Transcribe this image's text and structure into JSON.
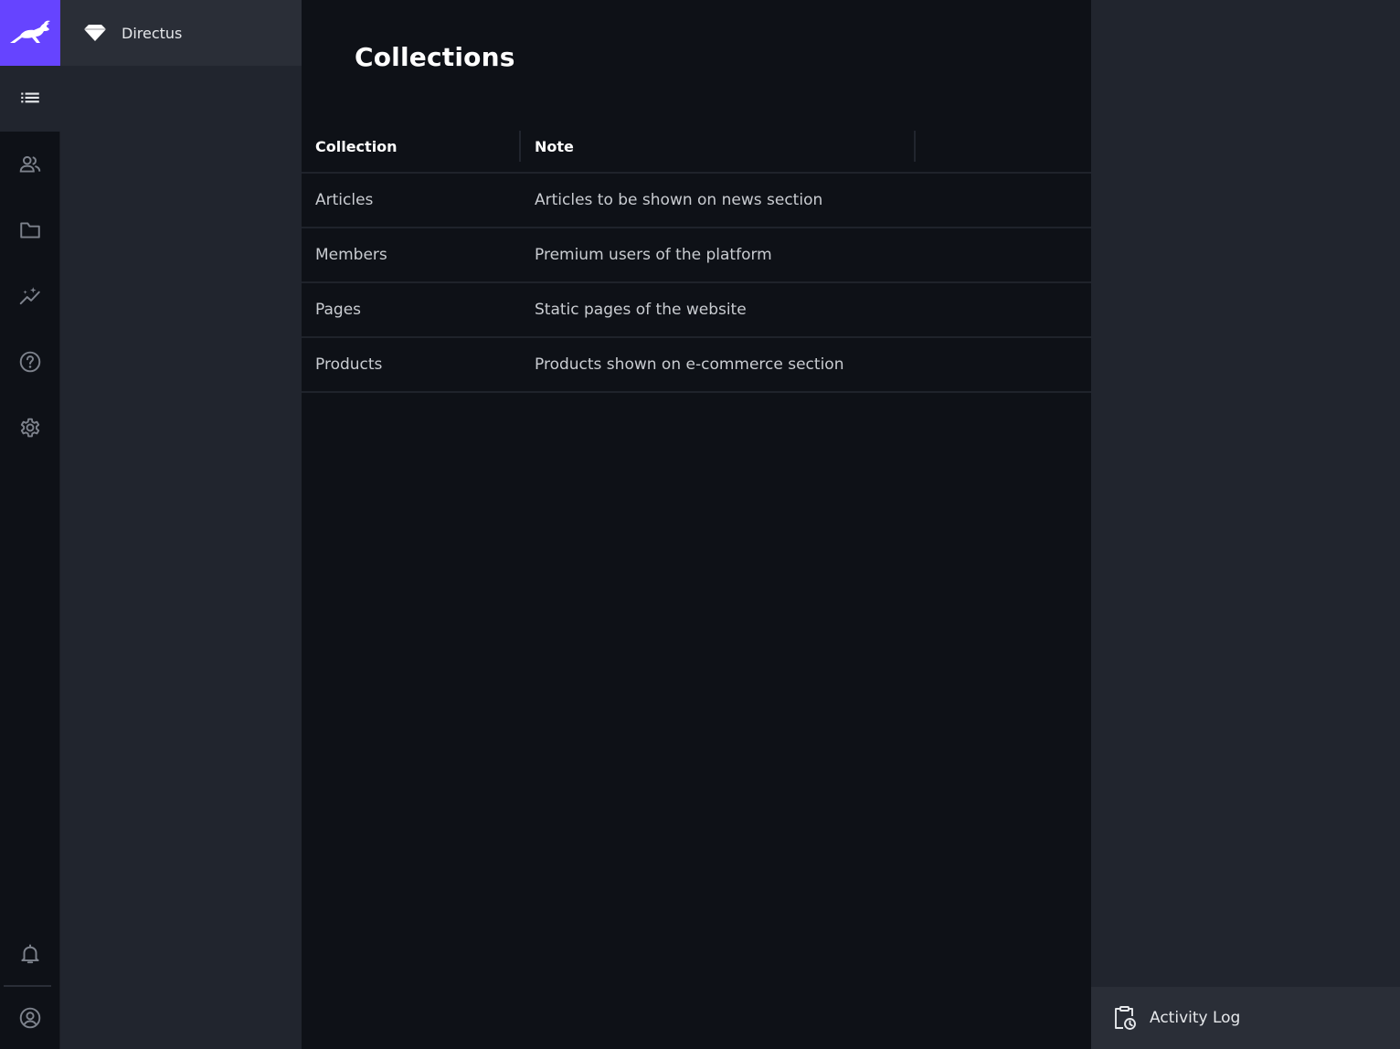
{
  "app": {
    "project_name": "Directus",
    "accent_color": "#6644ff"
  },
  "modules": [
    {
      "name": "content",
      "icon": "list-icon",
      "active": true
    },
    {
      "name": "users",
      "icon": "people-icon"
    },
    {
      "name": "files",
      "icon": "folder-icon"
    },
    {
      "name": "insights",
      "icon": "insights-icon"
    },
    {
      "name": "help",
      "icon": "help-icon"
    },
    {
      "name": "settings",
      "icon": "gear-icon"
    },
    {
      "name": "notifications",
      "icon": "bell-icon"
    },
    {
      "name": "user-menu",
      "icon": "account-icon"
    }
  ],
  "main": {
    "title": "Collections",
    "table": {
      "headers": [
        "Collection",
        "Note"
      ],
      "rows": [
        {
          "collection": "Articles",
          "note": "Articles to be shown on news section"
        },
        {
          "collection": "Members",
          "note": "Premium users of the platform"
        },
        {
          "collection": "Pages",
          "note": "Static pages of the website"
        },
        {
          "collection": "Products",
          "note": "Products shown on e-commerce section"
        }
      ]
    }
  },
  "sidebar": {
    "activity_label": "Activity Log"
  }
}
